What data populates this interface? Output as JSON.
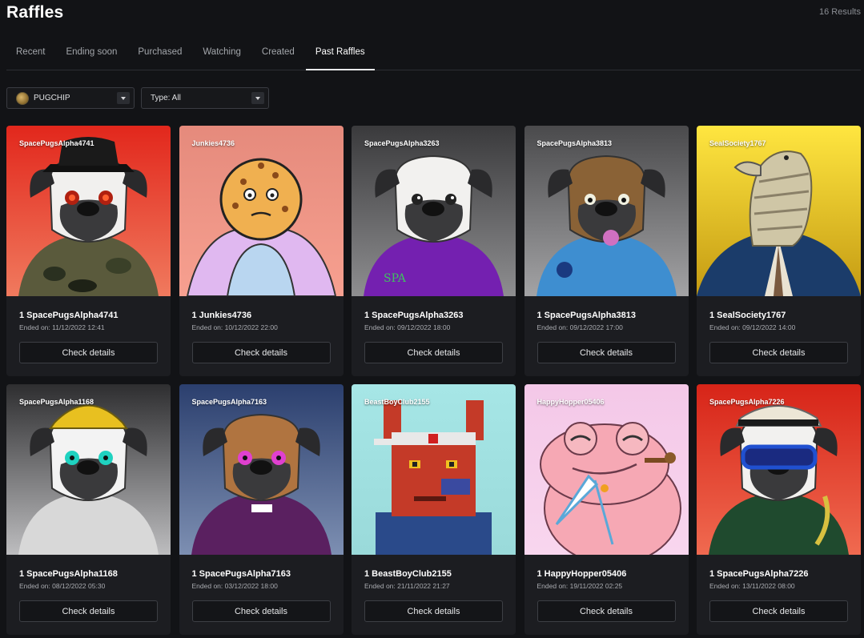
{
  "header": {
    "title": "Raffles",
    "results": "16 Results"
  },
  "tabs": [
    {
      "label": "Recent",
      "active": false
    },
    {
      "label": "Ending soon",
      "active": false
    },
    {
      "label": "Purchased",
      "active": false
    },
    {
      "label": "Watching",
      "active": false
    },
    {
      "label": "Created",
      "active": false
    },
    {
      "label": "Past Raffles",
      "active": true
    }
  ],
  "filters": {
    "token": {
      "value": "PUGCHIP",
      "icon": "pugchip-coin-icon"
    },
    "type": {
      "value": "Type: All"
    }
  },
  "cards": [
    {
      "label": "SpacePugsAlpha4741",
      "title": "1 SpacePugsAlpha4741",
      "ended": "Ended on: 11/12/2022 12:41",
      "button": "Check details",
      "bg_top": "#e2271c",
      "bg_bottom": "#f07a5e",
      "subject": "pug-camo-hat",
      "fur": "#f1f0ee",
      "outfit": "#5a5a3c",
      "accent": "#1a1a1a"
    },
    {
      "label": "Junkies4736",
      "title": "1 Junkies4736",
      "ended": "Ended on: 10/12/2022 22:00",
      "button": "Check details",
      "bg_top": "#e58a7c",
      "bg_bottom": "#f7a090",
      "subject": "cookie-head",
      "fur": "#f0b050",
      "outfit": "#b9d6f0",
      "accent": "#e0b8f0"
    },
    {
      "label": "SpacePugsAlpha3263",
      "title": "1 SpacePugsAlpha3263",
      "ended": "Ended on: 09/12/2022 18:00",
      "button": "Check details",
      "bg_top": "#3a3a3c",
      "bg_bottom": "#8e8e90",
      "subject": "pug-purple-shirt",
      "fur": "#f2f1ef",
      "outfit": "#7420b0",
      "accent": "#1a1a1a"
    },
    {
      "label": "SpacePugsAlpha3813",
      "title": "1 SpacePugsAlpha3813",
      "ended": "Ended on: 09/12/2022 17:00",
      "button": "Check details",
      "bg_top": "#4a4a4c",
      "bg_bottom": "#a3a3a5",
      "subject": "pug-police",
      "fur": "#8a6236",
      "outfit": "#3e8ed0",
      "accent": "#1a1a1a"
    },
    {
      "label": "SealSociety1767",
      "title": "1 SealSociety1767",
      "ended": "Ended on: 09/12/2022 14:00",
      "button": "Check details",
      "bg_top": "#ffe640",
      "bg_bottom": "#c49a12",
      "subject": "seal-suit",
      "fur": "#cfc6a6",
      "outfit": "#1b3c6a",
      "accent": "#2a2a2a"
    },
    {
      "label": "SpacePugsAlpha1168",
      "title": "1 SpacePugsAlpha1168",
      "ended": "Ended on: 08/12/2022 05:30",
      "button": "Check details",
      "bg_top": "#2e2e30",
      "bg_bottom": "#bdbdbf",
      "subject": "pug-hardhat",
      "fur": "#f3f3f3",
      "outfit": "#d8d8d8",
      "accent": "#e8c020"
    },
    {
      "label": "SpacePugsAlpha7163",
      "title": "1 SpacePugsAlpha7163",
      "ended": "Ended on: 03/12/2022 18:00",
      "button": "Check details",
      "bg_top": "#2b3f6e",
      "bg_bottom": "#7d8fb2",
      "subject": "pug-priest",
      "fur": "#b07440",
      "outfit": "#5a2060",
      "accent": "#1a1a1a"
    },
    {
      "label": "BeastBoyClub2155",
      "title": "1 BeastBoyClub2155",
      "ended": "Ended on: 21/11/2022 21:27",
      "button": "Check details",
      "bg_top": "#a6e6e6",
      "bg_bottom": "#9adada",
      "subject": "pixel-beast",
      "fur": "#c43a28",
      "outfit": "#2a4a8a",
      "accent": "#e8e8e8"
    },
    {
      "label": "HappyHopper05406",
      "title": "1 HappyHopper05406",
      "ended": "Ended on: 19/11/2022 02:25",
      "button": "Check details",
      "bg_top": "#f4c8e8",
      "bg_bottom": "#f8d6ee",
      "subject": "pink-frog",
      "fur": "#f6a8b4",
      "outfit": "#f6a8b4",
      "accent": "#7ab8e0"
    },
    {
      "label": "SpacePugsAlpha7226",
      "title": "1 SpacePugsAlpha7226",
      "ended": "Ended on: 13/11/2022 08:00",
      "button": "Check details",
      "bg_top": "#d72418",
      "bg_bottom": "#f06a50",
      "subject": "pug-goggles",
      "fur": "#f2f1ef",
      "outfit": "#1f4a2e",
      "accent": "#2050d0"
    }
  ]
}
